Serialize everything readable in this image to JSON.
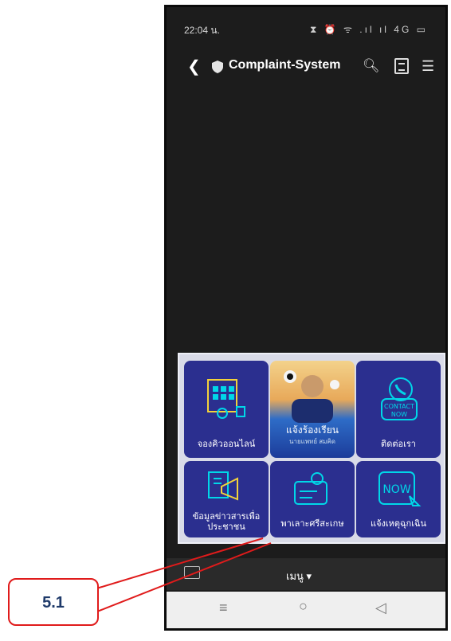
{
  "status_bar": {
    "time": "22:04 น.",
    "icons": "⧗ ⏰ ᯤ .ıl ıl 4G ▭"
  },
  "app_bar": {
    "title": "Complaint-System"
  },
  "tiles": [
    {
      "label": "จองคิวออนไลน์"
    },
    {
      "label": "แจ้งร้องเรียน",
      "sublabel": "นายแพทย์ สมคิด"
    },
    {
      "label": "ติดต่อเรา"
    },
    {
      "label": "ข้อมูลข่าวสารเพื่อประชาชน"
    },
    {
      "label": "พาเลาะศรีสะเกษ"
    },
    {
      "label": "แจ้งเหตุฉุกเฉิน"
    }
  ],
  "bottom_bar": {
    "menu": "เมนู ▾"
  },
  "callout": {
    "label": "5.1"
  },
  "colors": {
    "tile": "#2b2f8f",
    "accent": "#00d7e8",
    "callout": "#e01b1b"
  }
}
